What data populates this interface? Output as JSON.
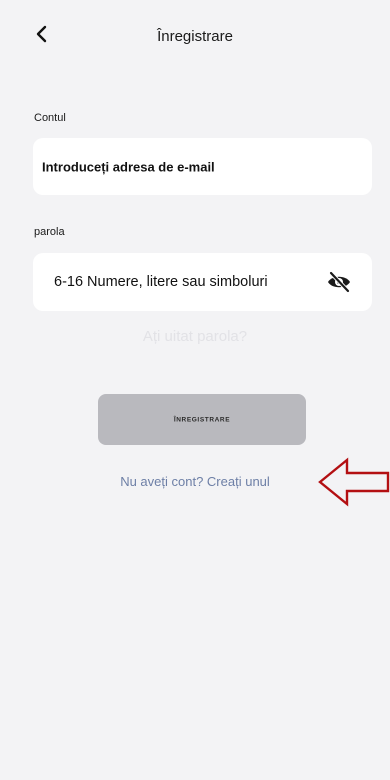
{
  "header": {
    "title": "Înregistrare",
    "back_icon": "chevron-left-icon"
  },
  "account": {
    "label": "Contul",
    "email_placeholder": "Introduceți adresa de e-mail"
  },
  "password": {
    "label": "parola",
    "placeholder": "6-16 Numere, litere sau simboluri",
    "visibility_icon": "eye-off-icon"
  },
  "links": {
    "forgot": "Ați uitat parola?",
    "signup": "Nu aveți cont? Creați unul"
  },
  "actions": {
    "register_label": "Înregistrare"
  },
  "annotation": {
    "arrow_color": "#b30f12",
    "arrow_icon": "left-arrow-outline"
  },
  "colors": {
    "background": "#f3f3f5",
    "field_bg": "#ffffff",
    "button_bg": "#b9b9be",
    "link": "#6d7fa6",
    "muted_link": "#e2e2e6"
  }
}
